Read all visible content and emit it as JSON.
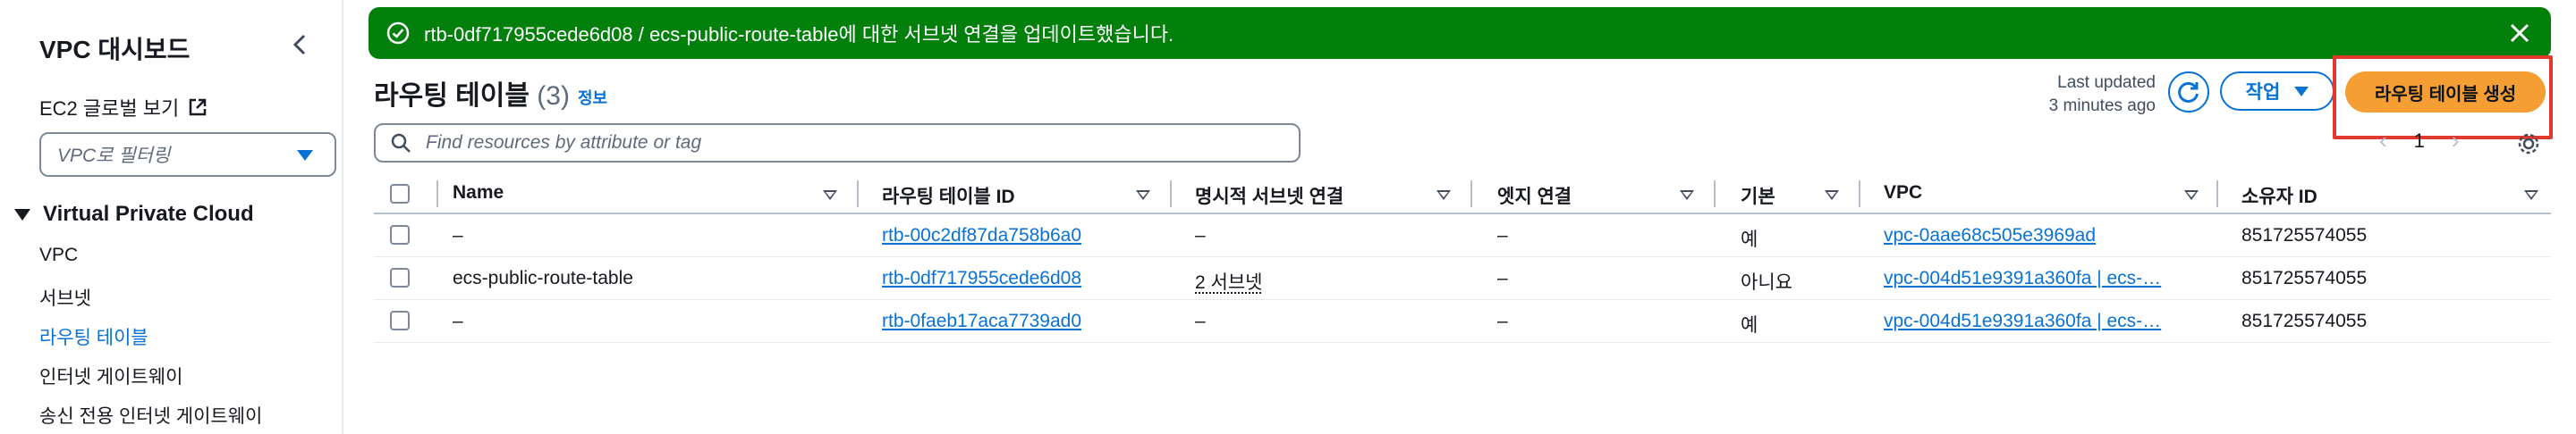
{
  "sidebar": {
    "title": "VPC 대시보드",
    "ec2_link": "EC2 글로벌 보기",
    "filter_placeholder": "VPC로 필터링",
    "section_title": "Virtual Private Cloud",
    "items": [
      {
        "label": "VPC",
        "active": false
      },
      {
        "label": "서브넷",
        "active": false
      },
      {
        "label": "라우팅 테이블",
        "active": true
      },
      {
        "label": "인터넷 게이트웨이",
        "active": false
      },
      {
        "label": "송신 전용 인터넷 게이트웨이",
        "active": false
      }
    ]
  },
  "flash": {
    "message": "rtb-0df717955cede6d08 / ecs-public-route-table에 대한 서브넷 연결을 업데이트했습니다.",
    "color": "#037f0c"
  },
  "header": {
    "title": "라우팅 테이블",
    "count": "(3)",
    "info": "정보",
    "last_updated_line1": "Last updated",
    "last_updated_line2": "3 minutes ago",
    "actions_label": "작업",
    "create_label": "라우팅 테이블 생성",
    "create_color": "#f59e33"
  },
  "search": {
    "placeholder": "Find resources by attribute or tag"
  },
  "pagination": {
    "current_page": "1"
  },
  "table": {
    "columns": [
      "Name",
      "라우팅 테이블 ID",
      "명시적 서브넷 연결",
      "엣지 연결",
      "기본",
      "VPC",
      "소유자 ID"
    ],
    "rows": [
      {
        "name": "–",
        "route_table_id": "rtb-00c2df87da758b6a0",
        "explicit_subnets": "–",
        "edge": "–",
        "main": "예",
        "vpc": "vpc-0aae68c505e3969ad",
        "owner": "851725574055"
      },
      {
        "name": "ecs-public-route-table",
        "route_table_id": "rtb-0df717955cede6d08",
        "explicit_subnets": "2 서브넷",
        "edge": "–",
        "main": "아니요",
        "vpc": "vpc-004d51e9391a360fa | ecs-…",
        "owner": "851725574055"
      },
      {
        "name": "–",
        "route_table_id": "rtb-0faeb17aca7739ad0",
        "explicit_subnets": "–",
        "edge": "–",
        "main": "예",
        "vpc": "vpc-004d51e9391a360fa | ecs-…",
        "owner": "851725574055"
      }
    ]
  }
}
